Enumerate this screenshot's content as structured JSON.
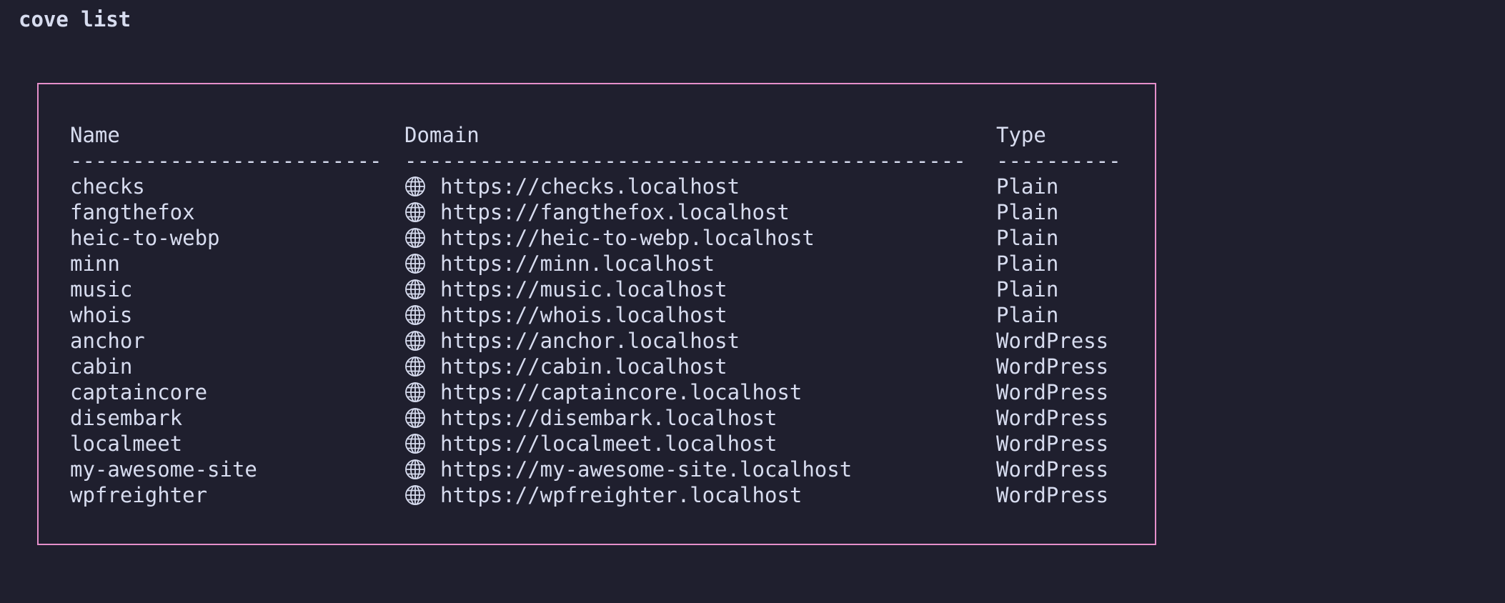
{
  "command": "cove list",
  "table": {
    "headers": {
      "name": "Name",
      "domain": "Domain",
      "type": "Type"
    },
    "dividers": {
      "name": "-------------------------",
      "domain": "---------------------------------------------",
      "type": "----------"
    },
    "rows": [
      {
        "name": "checks",
        "icon": "globe-icon",
        "domain": "https://checks.localhost",
        "type": "Plain"
      },
      {
        "name": "fangthefox",
        "icon": "globe-icon",
        "domain": "https://fangthefox.localhost",
        "type": "Plain"
      },
      {
        "name": "heic-to-webp",
        "icon": "globe-icon",
        "domain": "https://heic-to-webp.localhost",
        "type": "Plain"
      },
      {
        "name": "minn",
        "icon": "globe-icon",
        "domain": "https://minn.localhost",
        "type": "Plain"
      },
      {
        "name": "music",
        "icon": "globe-icon",
        "domain": "https://music.localhost",
        "type": "Plain"
      },
      {
        "name": "whois",
        "icon": "globe-icon",
        "domain": "https://whois.localhost",
        "type": "Plain"
      },
      {
        "name": "anchor",
        "icon": "globe-icon",
        "domain": "https://anchor.localhost",
        "type": "WordPress"
      },
      {
        "name": "cabin",
        "icon": "globe-icon",
        "domain": "https://cabin.localhost",
        "type": "WordPress"
      },
      {
        "name": "captaincore",
        "icon": "globe-icon",
        "domain": "https://captaincore.localhost",
        "type": "WordPress"
      },
      {
        "name": "disembark",
        "icon": "globe-icon",
        "domain": "https://disembark.localhost",
        "type": "WordPress"
      },
      {
        "name": "localmeet",
        "icon": "globe-icon",
        "domain": "https://localmeet.localhost",
        "type": "WordPress"
      },
      {
        "name": "my-awesome-site",
        "icon": "globe-icon",
        "domain": "https://my-awesome-site.localhost",
        "type": "WordPress"
      },
      {
        "name": "wpfreighter",
        "icon": "globe-icon",
        "domain": "https://wpfreighter.localhost",
        "type": "WordPress"
      }
    ]
  },
  "colors": {
    "background": "#1f1f2e",
    "text": "#d7dcef",
    "border": "#e58fca"
  }
}
